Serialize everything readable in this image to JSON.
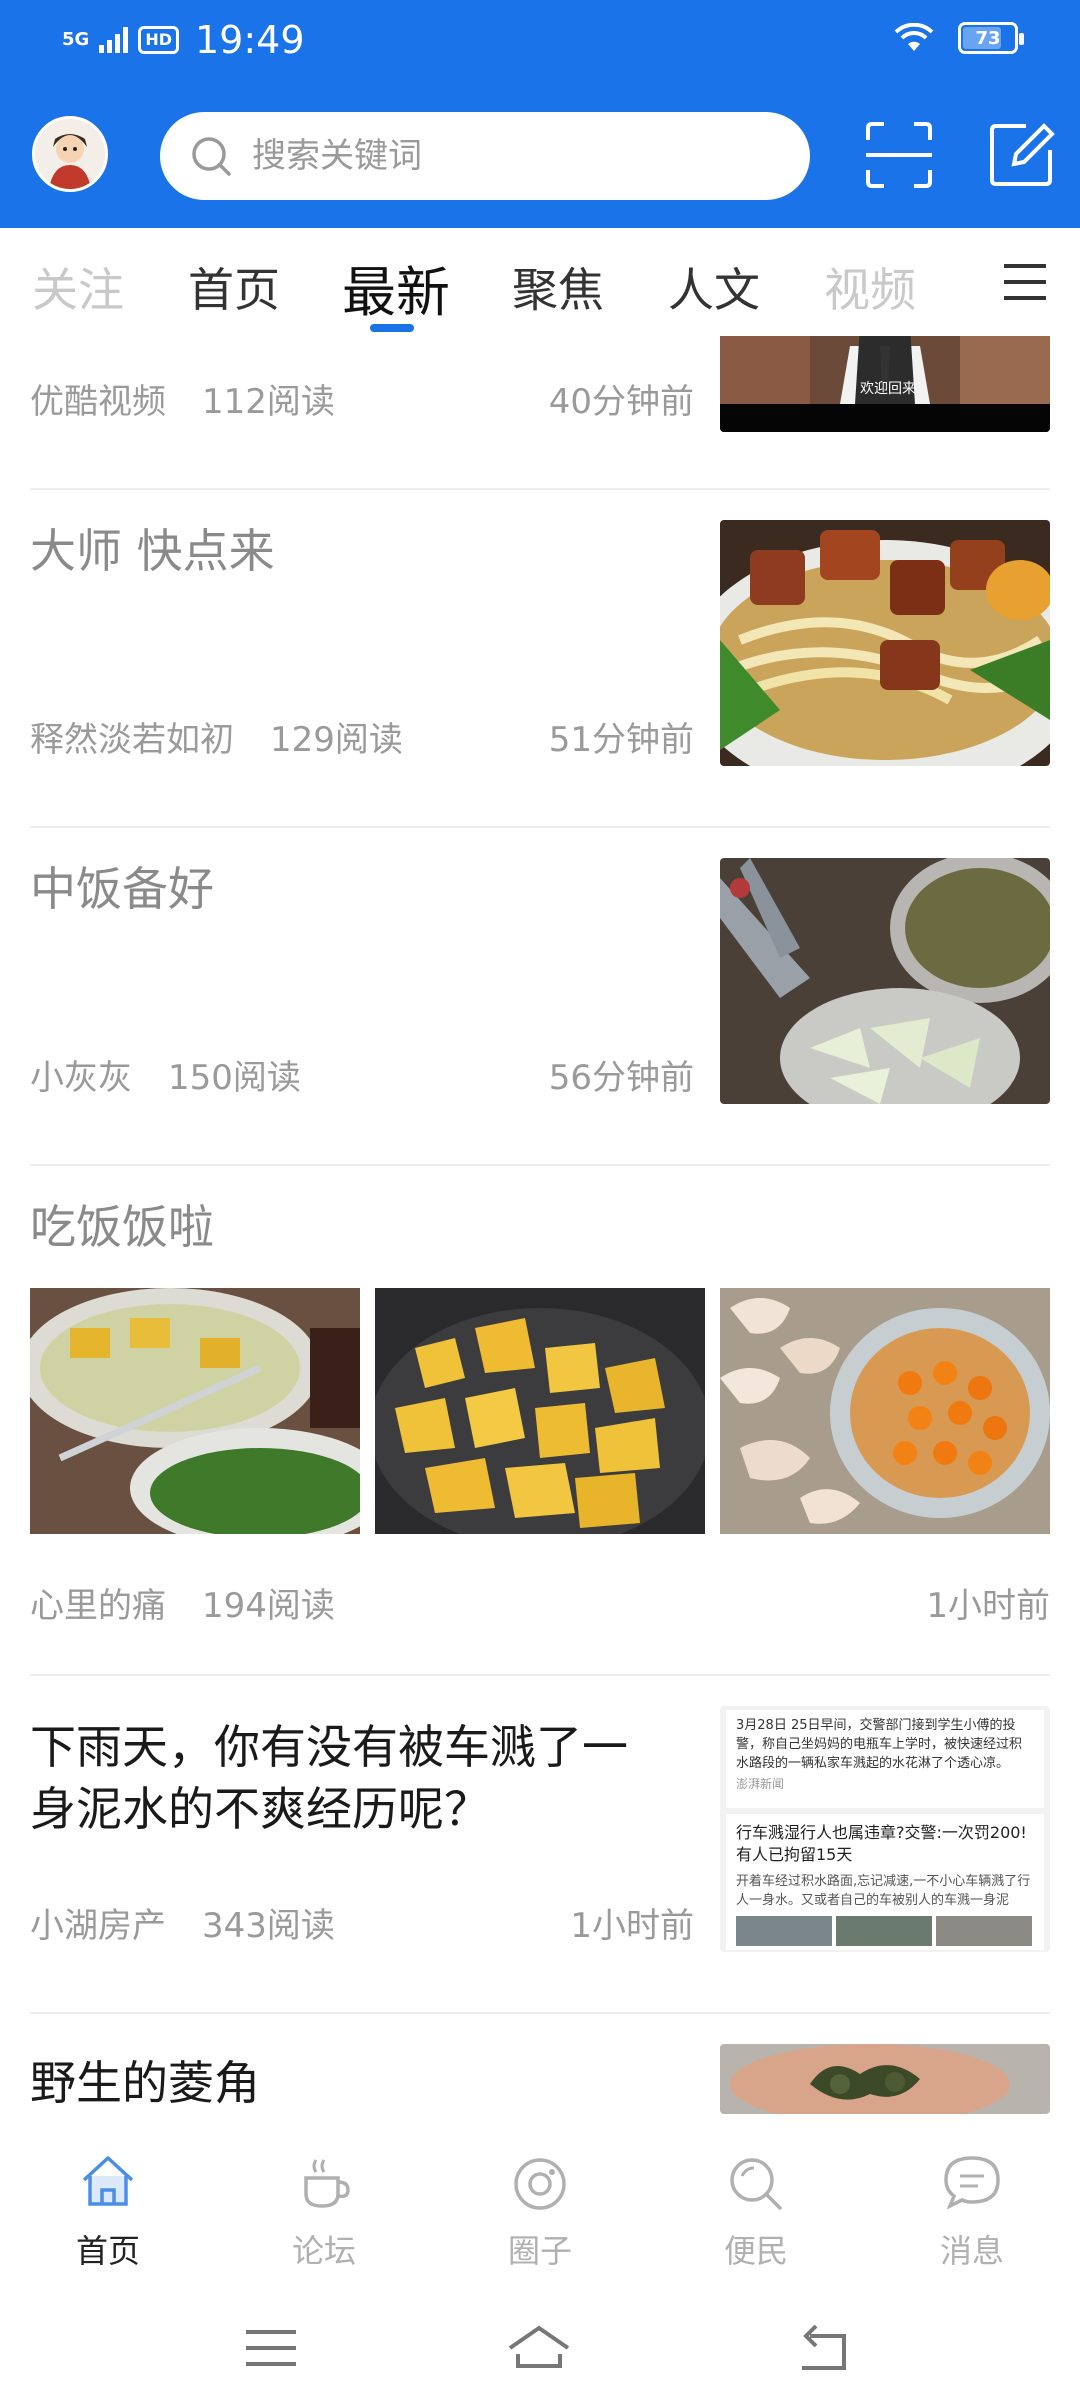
{
  "status_bar": {
    "network": "5G",
    "hd": "HD",
    "time": "19:49",
    "battery": "73"
  },
  "search": {
    "placeholder": "搜索关键词"
  },
  "tabs": [
    {
      "label": "关注"
    },
    {
      "label": "首页"
    },
    {
      "label": "最新"
    },
    {
      "label": "聚焦"
    },
    {
      "label": "人文"
    },
    {
      "label": "视频"
    }
  ],
  "active_tab": "最新",
  "feed": [
    {
      "title": "",
      "author": "优酷视频",
      "reads": "112阅读",
      "time": "40分钟前",
      "thumb_caption": "欢迎回来"
    },
    {
      "title": "大师 快点来",
      "author": "释然淡若如初",
      "reads": "129阅读",
      "time": "51分钟前"
    },
    {
      "title": "中饭备好",
      "author": "小灰灰",
      "reads": "150阅读",
      "time": "56分钟前"
    },
    {
      "title": "吃饭饭啦",
      "author": "心里的痛",
      "reads": "194阅读",
      "time": "1小时前"
    },
    {
      "title": "下雨天，你有没有被车溅了一身泥水的不爽经历呢？",
      "author": "小湖房产",
      "reads": "343阅读",
      "time": "1小时前",
      "thumb_text": {
        "top": "3月28日 25日早间，交警部门接到学生小傅的投警，称自己坐妈妈的电瓶车上学时，被快速经过积水路段的一辆私家车溅起的水花淋了个透心凉。",
        "source": "澎湃新闻",
        "headline": "行车溅湿行人也属违章?交警:一次罚200!有人已拘留15天",
        "body": "开着车经过积水路面,忘记减速,一不小心车辆溅了行人一身水。又或者自己的车被别人的车溅一身泥水..."
      }
    },
    {
      "title": "野生的菱角",
      "author": "",
      "reads": "",
      "time": ""
    }
  ],
  "bottom_nav": [
    {
      "label": "首页",
      "icon": "home-icon",
      "active": true
    },
    {
      "label": "论坛",
      "icon": "coffee-cup-icon",
      "active": false
    },
    {
      "label": "圈子",
      "icon": "circle-icon",
      "active": false
    },
    {
      "label": "便民",
      "icon": "search-icon",
      "active": false
    },
    {
      "label": "消息",
      "icon": "chat-bubble-icon",
      "active": false
    }
  ],
  "colors": {
    "brand": "#1a73e8",
    "text_muted": "#9a9a9a"
  }
}
